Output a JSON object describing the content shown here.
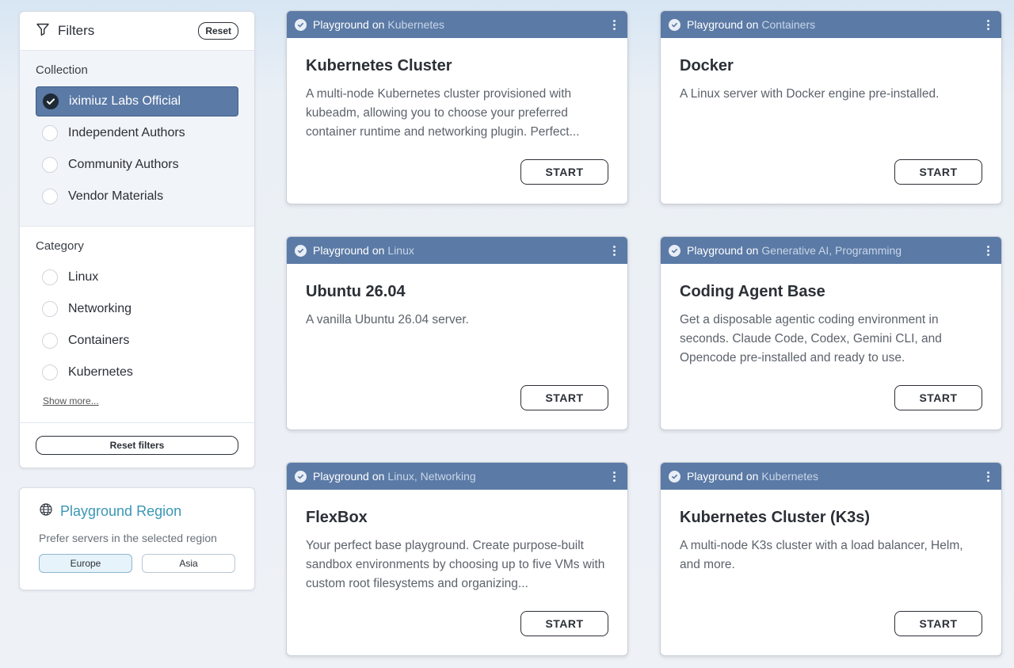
{
  "filters": {
    "title": "Filters",
    "reset_label": "Reset",
    "collection": {
      "title": "Collection",
      "options": [
        {
          "label": "iximiuz Labs Official",
          "checked": true
        },
        {
          "label": "Independent Authors",
          "checked": false
        },
        {
          "label": "Community Authors",
          "checked": false
        },
        {
          "label": "Vendor Materials",
          "checked": false
        }
      ]
    },
    "category": {
      "title": "Category",
      "options": [
        {
          "label": "Linux",
          "checked": false
        },
        {
          "label": "Networking",
          "checked": false
        },
        {
          "label": "Containers",
          "checked": false
        },
        {
          "label": "Kubernetes",
          "checked": false
        }
      ],
      "show_more": "Show more..."
    },
    "reset_filters_label": "Reset filters"
  },
  "region": {
    "title": "Playground Region",
    "description": "Prefer servers in the selected region",
    "options": [
      {
        "label": "Europe",
        "active": true
      },
      {
        "label": "Asia",
        "active": false
      }
    ]
  },
  "cards": [
    {
      "prefix": "Playground",
      "on": "on",
      "categories": "Kubernetes",
      "title": "Kubernetes Cluster",
      "description": "A multi-node Kubernetes cluster provisioned with kubeadm, allowing you to choose your preferred container runtime and networking plugin. Perfect...",
      "button": "START"
    },
    {
      "prefix": "Playground",
      "on": "on",
      "categories": "Containers",
      "title": "Docker",
      "description": "A Linux server with Docker engine pre-installed.",
      "button": "START"
    },
    {
      "prefix": "Playground",
      "on": "on",
      "categories": "Linux",
      "title": "Ubuntu 26.04",
      "description": "A vanilla Ubuntu 26.04 server.",
      "button": "START"
    },
    {
      "prefix": "Playground",
      "on": "on",
      "categories": "Generative AI, Programming",
      "title": "Coding Agent Base",
      "description": "Get a disposable agentic coding environment in seconds. Claude Code, Codex, Gemini CLI, and Opencode pre-installed and ready to use.",
      "button": "START"
    },
    {
      "prefix": "Playground",
      "on": "on",
      "categories": "Linux, Networking",
      "title": "FlexBox",
      "description": "Your perfect base playground. Create purpose-built sandbox environments by choosing up to five VMs with custom root filesystems and organizing...",
      "button": "START"
    },
    {
      "prefix": "Playground",
      "on": "on",
      "categories": "Kubernetes",
      "title": "Kubernetes Cluster (K3s)",
      "description": "A multi-node K3s cluster with a load balancer, Helm, and more.",
      "button": "START"
    }
  ],
  "colors": {
    "card_header": "#5b7aa6",
    "region_title": "#3a97b5",
    "checked_option": "#5b7aa6"
  }
}
